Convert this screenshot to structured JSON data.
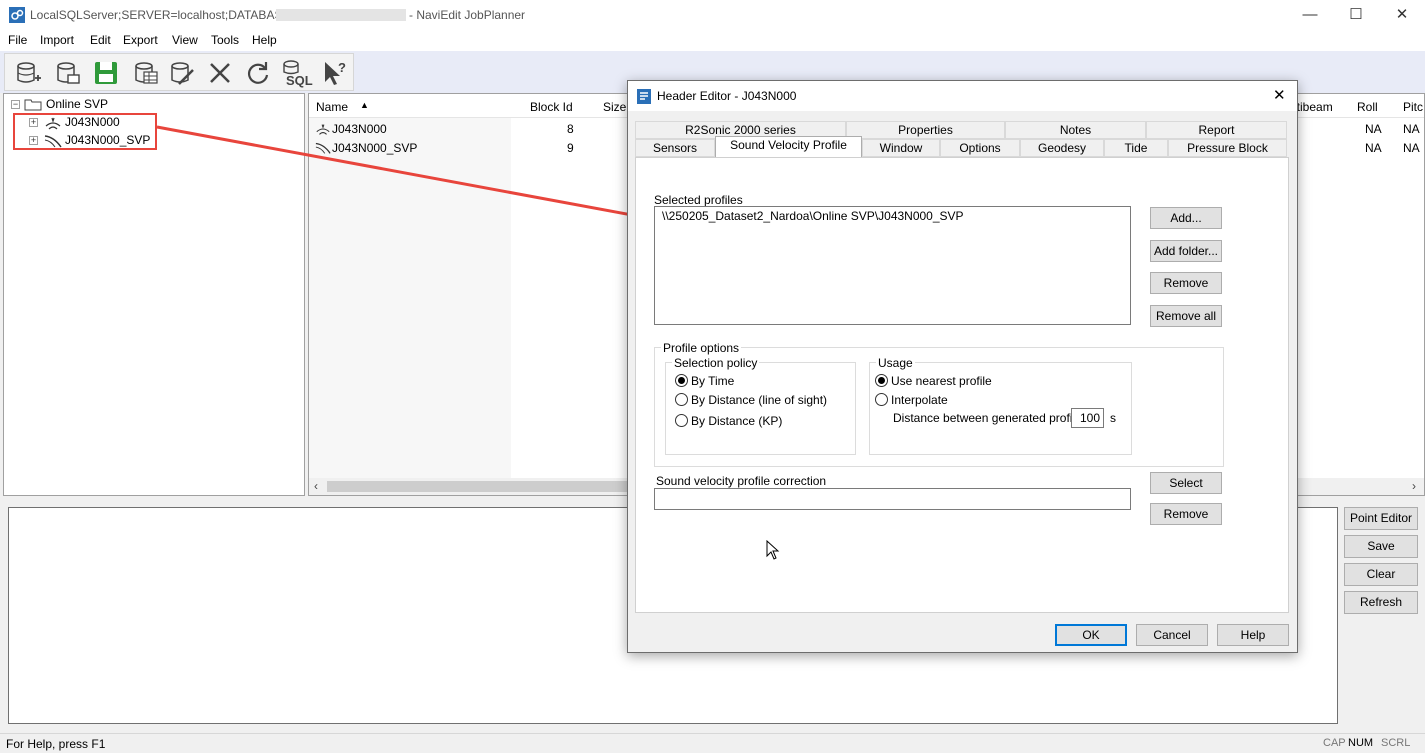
{
  "window": {
    "title_prefix": "LocalSQLServer;SERVER=localhost;DATABASE=",
    "title_suffix": "- NaviEdit JobPlanner",
    "minimize": "—",
    "maximize": "☐",
    "close": "✕"
  },
  "menu": [
    "File",
    "Import",
    "Edit",
    "Export",
    "View",
    "Tools",
    "Help"
  ],
  "toolbar": {
    "sql_label": "SQL"
  },
  "tree": {
    "root": "Online SVP",
    "children": [
      "J043N000",
      "J043N000_SVP"
    ]
  },
  "list": {
    "headers": {
      "name": "Name",
      "block_id": "Block Id",
      "size": "Size",
      "multibeam": "ltibeam",
      "roll": "Roll",
      "pitch": "Pitc"
    },
    "rows": [
      {
        "name": "J043N000",
        "block_id": "8",
        "roll": "NA",
        "pitch": "NA"
      },
      {
        "name": "J043N000_SVP",
        "block_id": "9",
        "roll": "NA",
        "pitch": "NA"
      }
    ]
  },
  "side_buttons": [
    "Point Editor",
    "Save",
    "Clear",
    "Refresh"
  ],
  "status": {
    "help": "For Help, press F1",
    "cap": "CAP",
    "num": "NUM",
    "scrl": "SCRL"
  },
  "dialog": {
    "title": "Header Editor - J043N000",
    "close": "✕",
    "tabs_row1": [
      "R2Sonic 2000 series",
      "Properties",
      "Notes",
      "Report"
    ],
    "tabs_row2": [
      "Sensors",
      "Sound Velocity Profile",
      "Window",
      "Options",
      "Geodesy",
      "Tide",
      "Pressure Block"
    ],
    "selected_profiles_label": "Selected profiles",
    "selected_profiles": [
      "\\\\250205_Dataset2_Nardoa\\Online SVP\\J043N000_SVP"
    ],
    "buttons": {
      "add": "Add...",
      "add_folder": "Add folder...",
      "remove": "Remove",
      "remove_all": "Remove all",
      "select": "Select",
      "remove2": "Remove",
      "ok": "OK",
      "cancel": "Cancel",
      "help": "Help"
    },
    "profile_options_label": "Profile options",
    "selection_policy": {
      "label": "Selection policy",
      "options": [
        "By Time",
        "By Distance (line of sight)",
        "By Distance (KP)"
      ],
      "selected": "By Time"
    },
    "usage": {
      "label": "Usage",
      "options": [
        "Use nearest profile",
        "Interpolate"
      ],
      "selected": "Use nearest profile",
      "distance_label": "Distance between generated profiles",
      "distance_value": "100",
      "distance_unit": "s"
    },
    "svp_correction_label": "Sound velocity profile correction",
    "svp_correction_value": ""
  },
  "colors": {
    "annotation": "#e8453c",
    "toolbar_bg": "#e8ebf7",
    "default_button_border": "#0078d7"
  }
}
